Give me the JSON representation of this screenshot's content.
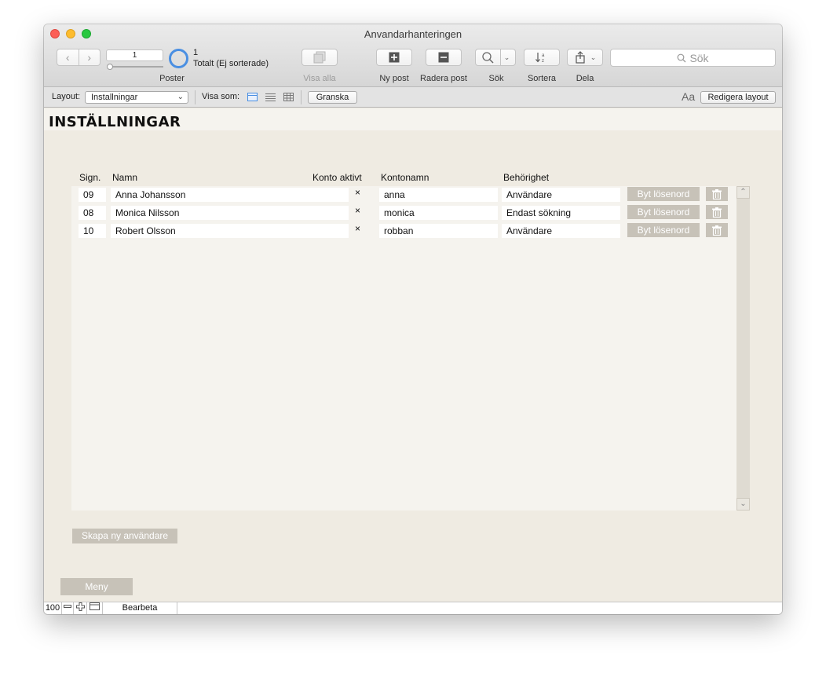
{
  "window": {
    "title": "Anvandarhanteringen"
  },
  "toolbar": {
    "record_number": "1",
    "found_count": "1",
    "found_status": "Totalt (Ej sorterade)",
    "records_label": "Poster",
    "show_all_label": "Visa alla",
    "new_record_label": "Ny post",
    "delete_record_label": "Radera post",
    "find_label": "Sök",
    "sort_label": "Sortera",
    "share_label": "Dela",
    "search_placeholder": "Sök"
  },
  "layout_bar": {
    "layout_label": "Layout:",
    "layout_value": "Installningar",
    "view_as_label": "Visa som:",
    "preview_label": "Granska",
    "font_icon_text": "Aa",
    "edit_layout_label": "Redigera layout"
  },
  "page": {
    "title": "INSTÄLLNINGAR",
    "columns": {
      "sign": "Sign.",
      "name": "Namn",
      "account_active": "Konto aktivt",
      "account_name": "Kontonamn",
      "privilege": "Behörighet"
    },
    "rows": [
      {
        "sign": "09",
        "name": "Anna Johansson",
        "active": "×",
        "account": "anna",
        "privilege": "Användare",
        "change_pw": "Byt lösenord"
      },
      {
        "sign": "08",
        "name": "Monica Nilsson",
        "active": "×",
        "account": "monica",
        "privilege": "Endast sökning",
        "change_pw": "Byt lösenord"
      },
      {
        "sign": "10",
        "name": "Robert Olsson",
        "active": "×",
        "account": "robban",
        "privilege": "Användare",
        "change_pw": "Byt lösenord"
      }
    ],
    "create_user_label": "Skapa ny användare",
    "menu_label": "Meny"
  },
  "status_bar": {
    "zoom": "100",
    "mode": "Bearbeta"
  },
  "colors": {
    "accent": "#4a8fe2",
    "button_bg": "#c7c2b8",
    "background": "#efebe2"
  }
}
